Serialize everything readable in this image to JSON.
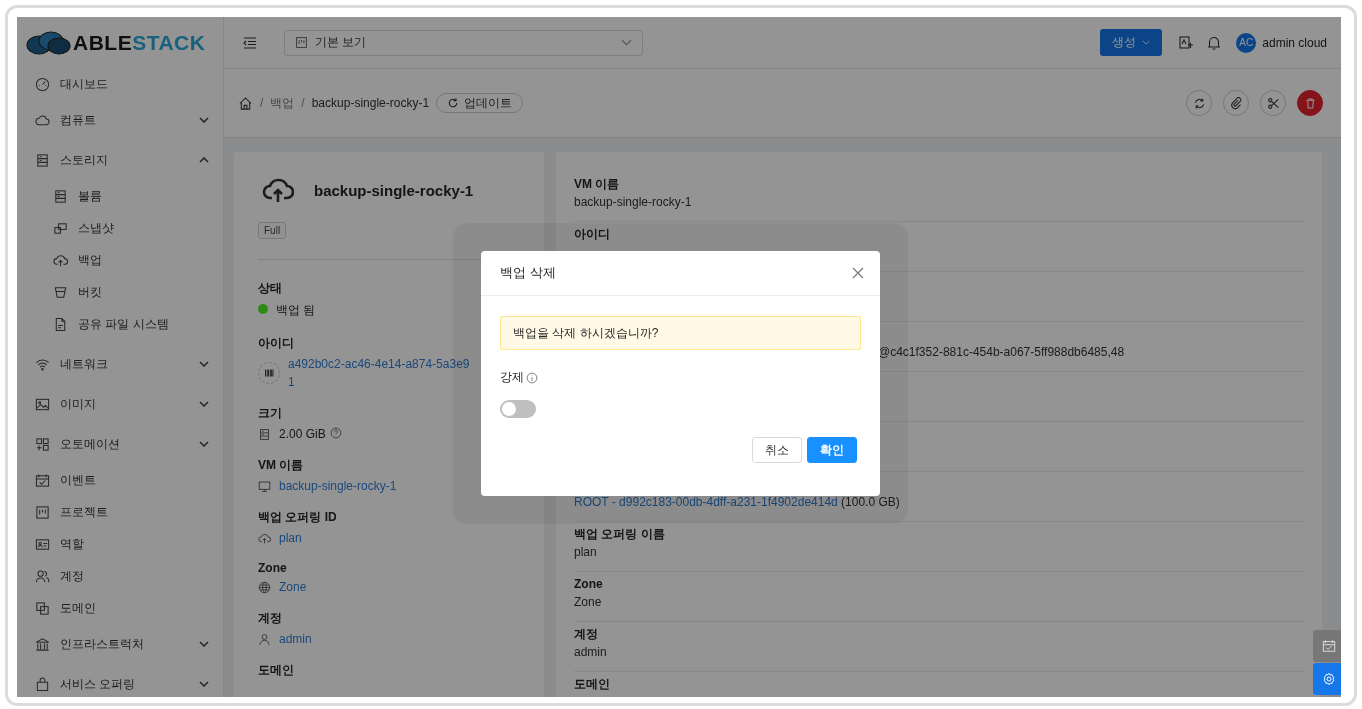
{
  "header": {
    "logo": {
      "dark": "ABLE",
      "light": "STACK"
    },
    "view_select": {
      "value": "기본 보기"
    },
    "create_button": "생성",
    "user": {
      "initials": "AC",
      "name": "admin cloud"
    }
  },
  "sidebar": {
    "items": [
      {
        "label": "대시보드"
      },
      {
        "label": "컴퓨트",
        "expanded": false
      },
      {
        "label": "스토리지",
        "expanded": true,
        "children": [
          {
            "label": "볼륨"
          },
          {
            "label": "스냅샷"
          },
          {
            "label": "백업"
          },
          {
            "label": "버킷"
          },
          {
            "label": "공유 파일 시스템"
          }
        ]
      },
      {
        "label": "네트워크",
        "expanded": false
      },
      {
        "label": "이미지",
        "expanded": false
      },
      {
        "label": "오토메이션",
        "expanded": false
      },
      {
        "label": "이벤트"
      },
      {
        "label": "프로젝트"
      },
      {
        "label": "역할"
      },
      {
        "label": "계정"
      },
      {
        "label": "도메인"
      },
      {
        "label": "인프라스트럭처",
        "expanded": false
      },
      {
        "label": "서비스 오퍼링",
        "expanded": false
      }
    ]
  },
  "breadcrumb": {
    "separator": "/",
    "items": [
      "백업",
      "backup-single-rocky-1"
    ],
    "update_button": "업데이트"
  },
  "detail_card": {
    "title": "backup-single-rocky-1",
    "tag": "Full",
    "fields": [
      {
        "kind": "status",
        "label": "상태",
        "value": "백업 됨",
        "color": "#2e8a12"
      },
      {
        "kind": "link",
        "label": "아이디",
        "lines": [
          "a492b0c2-ac46-4e14-a874-5a3e9",
          "1"
        ]
      },
      {
        "kind": "size",
        "label": "크기",
        "value": "2.00 GiB"
      },
      {
        "kind": "link",
        "label": "VM 이름",
        "lines": [
          "backup-single-rocky-1"
        ]
      },
      {
        "kind": "link",
        "label": "백업 오퍼링 ID",
        "lines": [
          "plan"
        ]
      },
      {
        "kind": "link",
        "label": "Zone",
        "lines": [
          "Zone"
        ]
      },
      {
        "kind": "link",
        "label": "계정",
        "lines": [
          "admin"
        ]
      },
      {
        "kind": "label",
        "label": "도메인"
      }
    ]
  },
  "info_rows": [
    {
      "kind": "text",
      "label": "VM 이름",
      "value": "backup-single-rocky-1"
    },
    {
      "kind": "text",
      "label": "아이디"
    },
    {
      "kind": "hidden"
    },
    {
      "kind": "clipped",
      "value": "@c4c1f352-881c-454b-a067-5ff988db6485,48"
    },
    {
      "kind": "hidden"
    },
    {
      "kind": "hidden"
    },
    {
      "kind": "volume",
      "link": "ROOT - d992c183-00db-4dff-a231-1f4902de414d",
      "suffix": "(100.0 GB)"
    },
    {
      "kind": "text",
      "label": "백업 오퍼링 이름",
      "value": "plan"
    },
    {
      "kind": "text",
      "label": "Zone",
      "value": "Zone"
    },
    {
      "kind": "text",
      "label": "계정",
      "value": "admin"
    },
    {
      "kind": "text",
      "label": "도메인"
    }
  ],
  "modal": {
    "title": "백업 삭제",
    "message": "백업을 삭제 하시겠습니까?",
    "field_label": "강제",
    "force_on": false,
    "cancel": "취소",
    "ok": "확인"
  }
}
